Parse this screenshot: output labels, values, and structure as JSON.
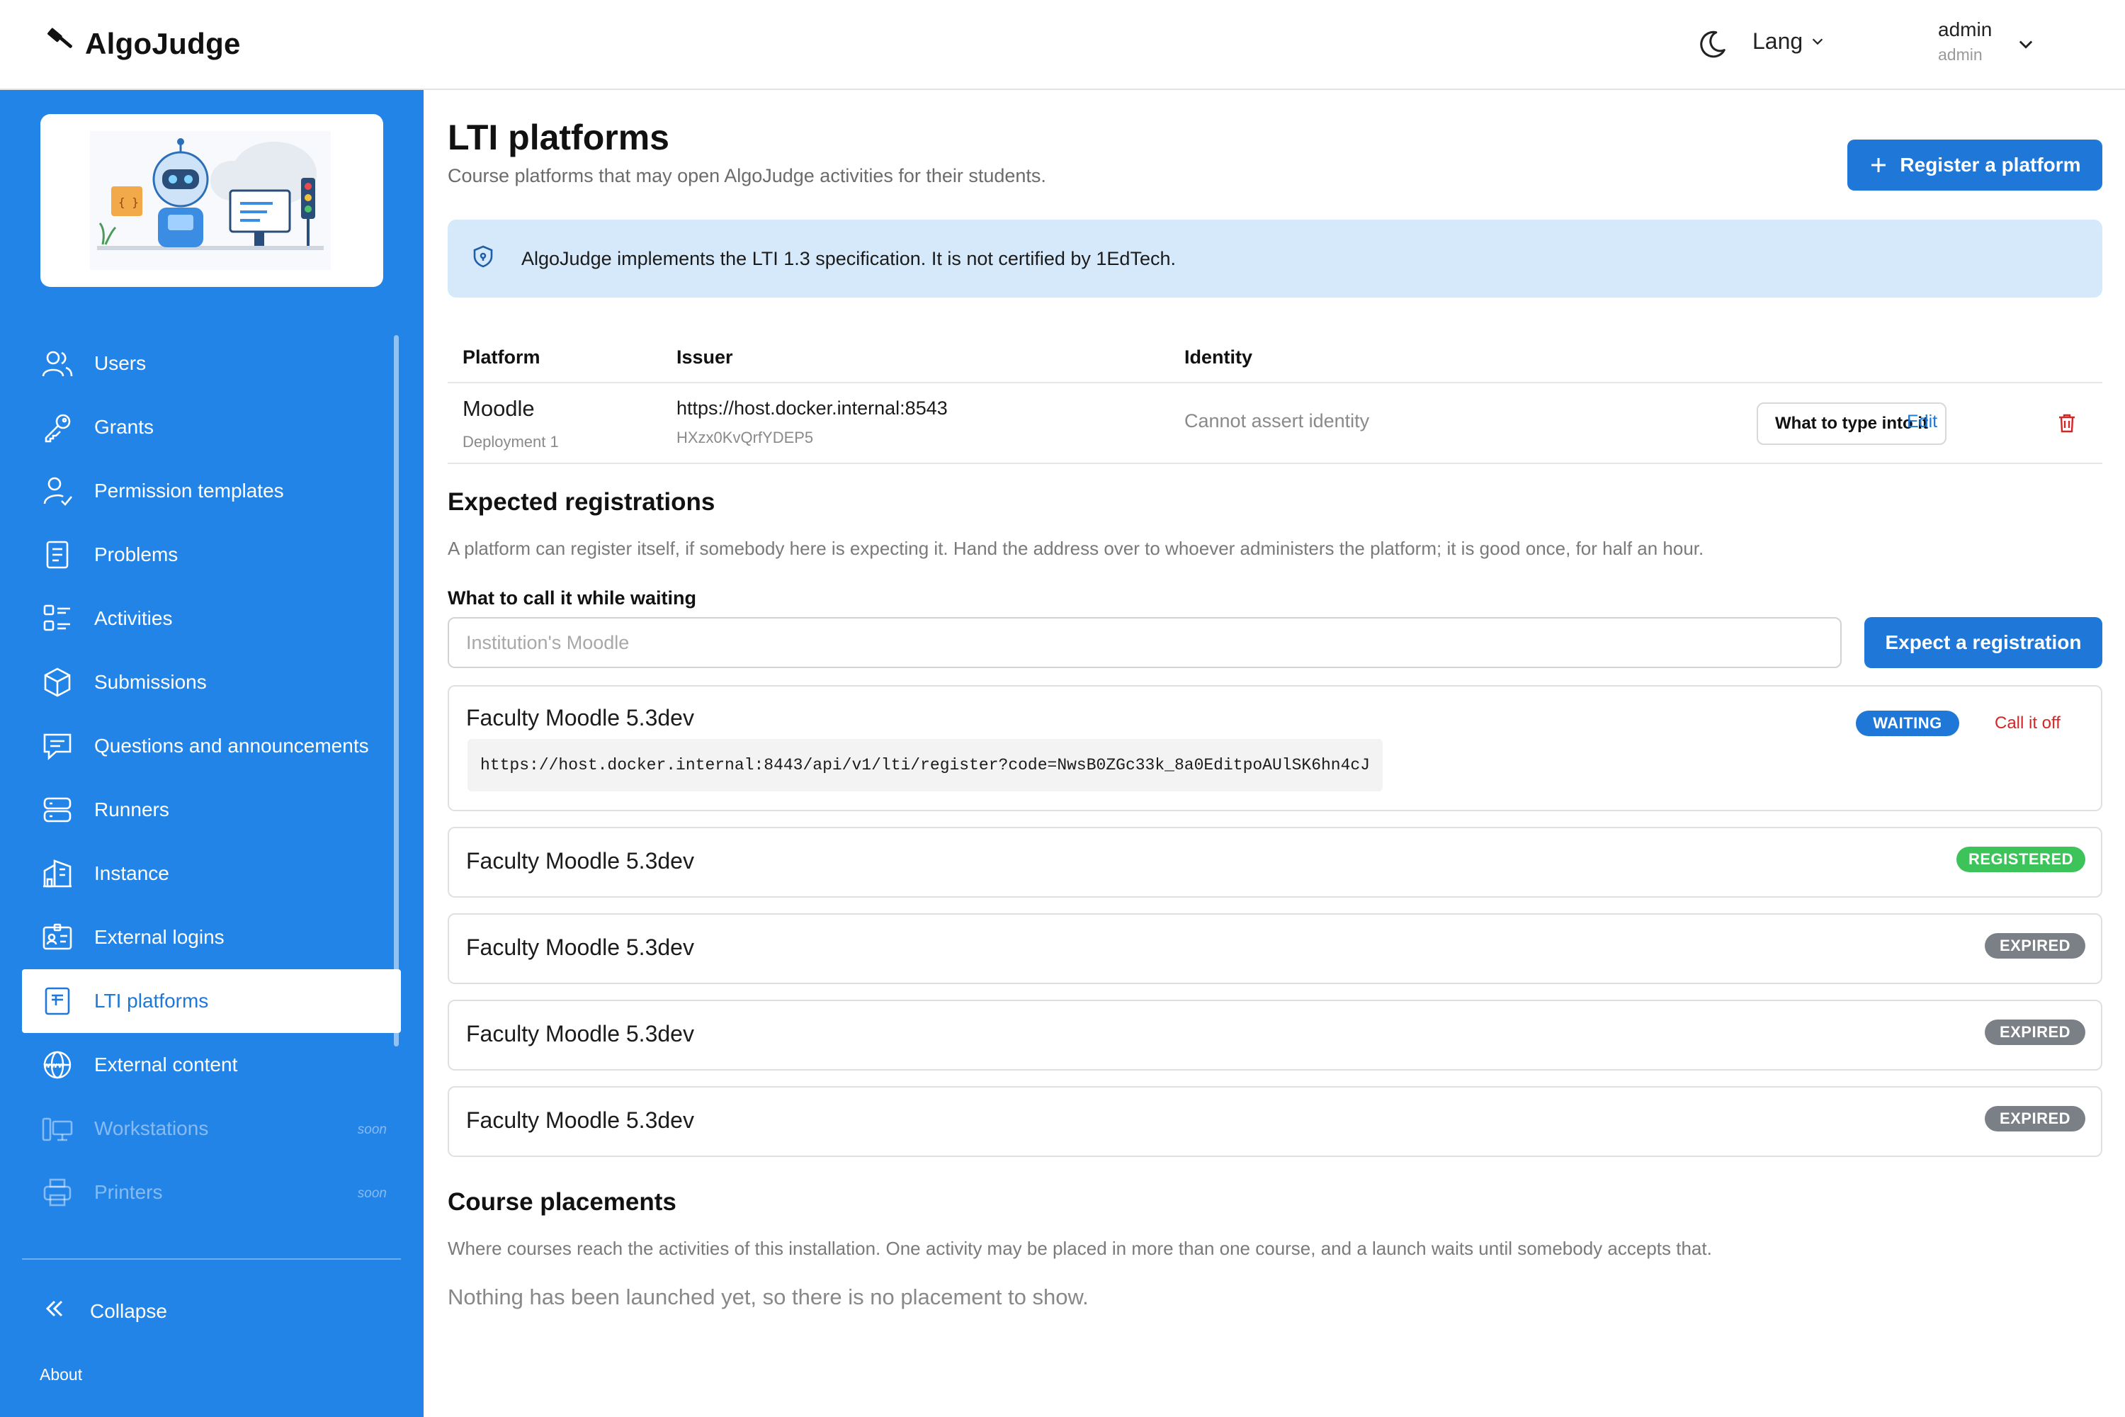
{
  "app": {
    "name": "AlgoJudge"
  },
  "header": {
    "lang_label": "Lang",
    "user_name": "admin",
    "user_role": "admin"
  },
  "sidebar": {
    "items": [
      {
        "label": "Users",
        "icon": "users-icon",
        "active": false,
        "disabled": false
      },
      {
        "label": "Grants",
        "icon": "key-icon",
        "active": false,
        "disabled": false
      },
      {
        "label": "Permission templates",
        "icon": "user-check-icon",
        "active": false,
        "disabled": false
      },
      {
        "label": "Problems",
        "icon": "document-icon",
        "active": false,
        "disabled": false
      },
      {
        "label": "Activities",
        "icon": "list-icon",
        "active": false,
        "disabled": false
      },
      {
        "label": "Submissions",
        "icon": "cube-icon",
        "active": false,
        "disabled": false
      },
      {
        "label": "Questions and announcements",
        "icon": "message-icon",
        "active": false,
        "disabled": false
      },
      {
        "label": "Runners",
        "icon": "server-icon",
        "active": false,
        "disabled": false
      },
      {
        "label": "Instance",
        "icon": "building-icon",
        "active": false,
        "disabled": false
      },
      {
        "label": "External logins",
        "icon": "id-card-icon",
        "active": false,
        "disabled": false
      },
      {
        "label": "LTI platforms",
        "icon": "file-text-icon",
        "active": true,
        "disabled": false
      },
      {
        "label": "External content",
        "icon": "www-icon",
        "active": false,
        "disabled": false
      },
      {
        "label": "Workstations",
        "icon": "workstation-icon",
        "active": false,
        "disabled": true,
        "tag": "soon"
      },
      {
        "label": "Printers",
        "icon": "printer-icon",
        "active": false,
        "disabled": true,
        "tag": "soon"
      }
    ],
    "collapse_label": "Collapse",
    "about_label": "About"
  },
  "page": {
    "title": "LTI platforms",
    "subtitle": "Course platforms that may open AlgoJudge activities for their students.",
    "register_button": "Register a platform",
    "info_text": "AlgoJudge implements the LTI 1.3 specification. It is not certified by 1EdTech."
  },
  "platforms_table": {
    "headers": {
      "platform": "Platform",
      "issuer": "Issuer",
      "identity": "Identity"
    },
    "rows": [
      {
        "platform": "Moodle",
        "deployment": "Deployment 1",
        "issuer": "https://host.docker.internal:8543",
        "client_id": "HXzx0KvQrfYDEP5",
        "identity": "Cannot assert identity",
        "type_button": "What to type into it",
        "edit_link": "Edit"
      }
    ]
  },
  "expected": {
    "title": "Expected registrations",
    "description": "A platform can register itself, if somebody here is expecting it. Hand the address over to whoever administers the platform; it is good once, for half an hour.",
    "field_label": "What to call it while waiting",
    "placeholder": "Institution's Moodle",
    "value": "",
    "button": "Expect a registration",
    "registrations": [
      {
        "name": "Faculty Moodle 5.3dev",
        "status": "WAITING",
        "action": "Call it off",
        "url": "https://host.docker.internal:8443/api/v1/lti/register?code=NwsB0ZGc33k_8a0EditpoAUlSK6hn4cJ"
      },
      {
        "name": "Faculty Moodle 5.3dev",
        "status": "REGISTERED"
      },
      {
        "name": "Faculty Moodle 5.3dev",
        "status": "EXPIRED"
      },
      {
        "name": "Faculty Moodle 5.3dev",
        "status": "EXPIRED"
      },
      {
        "name": "Faculty Moodle 5.3dev",
        "status": "EXPIRED"
      }
    ]
  },
  "placements": {
    "title": "Course placements",
    "description": "Where courses reach the activities of this installation. One activity may be placed in more than one course, and a launch waits until somebody accepts that.",
    "empty_message": "Nothing has been launched yet, so there is no placement to show."
  },
  "colors": {
    "primary": "#1f77d8",
    "sidebar": "#2384e8",
    "info_bg": "#d5e9fb",
    "registered": "#3cc35a",
    "expired": "#7b7f86",
    "danger": "#d32626"
  }
}
